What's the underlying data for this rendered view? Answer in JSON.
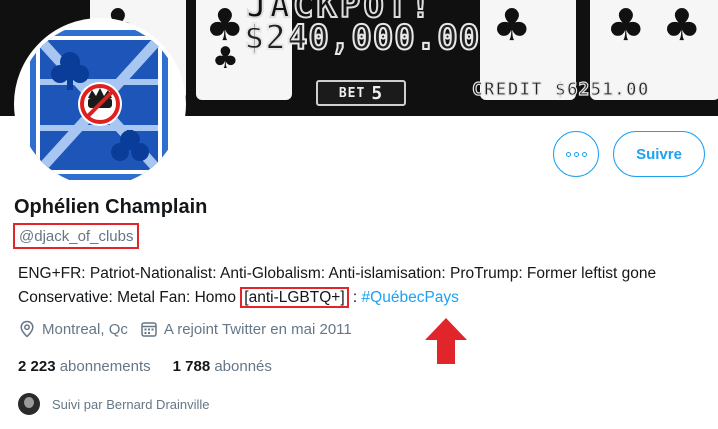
{
  "banner": {
    "title": "JACKPOT!",
    "amount": "$240,000.00",
    "bet_label": "BET",
    "bet_value": "5",
    "credit": "CREDIT $6251.00"
  },
  "profile": {
    "name": "Ophélien Champlain",
    "handle": "@djack_of_clubs",
    "bio_main": "ENG+FR: Patriot-Nationalist: Anti-Globalism: Anti-islamisation: ProTrump: Former leftist gone Conservative: Metal Fan: Homo ",
    "bio_highlight": "[anti-LGBTQ+]",
    "bio_after": " : ",
    "bio_hashtag": "#QuébecPays",
    "location": "Montreal, Qc",
    "joined": "A rejoint Twitter en mai 2011",
    "following_count": "2 223",
    "following_label": "abonnements",
    "followers_count": "1 788",
    "followers_label": "abonnés",
    "followed_by": "Suivi par Bernard Drainville"
  },
  "actions": {
    "more_icon": "more-dots-icon",
    "follow_label": "Suivre"
  },
  "colors": {
    "accent": "#1da1f2",
    "highlight_red": "#e0262a",
    "muted": "#657786"
  }
}
